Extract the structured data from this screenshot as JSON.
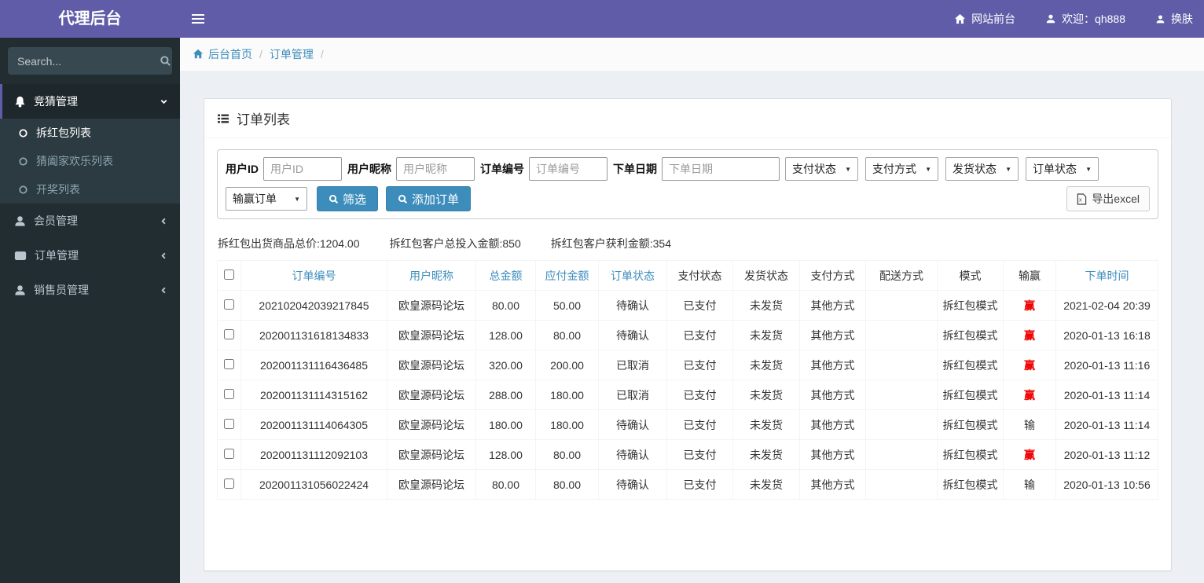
{
  "colors": {
    "accent": "#605ca8",
    "link": "#3c8dbc",
    "win_red": "#f00000",
    "sidebar_bg": "#222d32"
  },
  "app": {
    "title": "代理后台"
  },
  "navbar": {
    "links": [
      {
        "icon": "home-icon",
        "label": "网站前台"
      },
      {
        "icon": "user-icon",
        "label": "欢迎：qh888"
      },
      {
        "icon": "user-icon",
        "label": "换肤"
      }
    ]
  },
  "sidebar": {
    "search_placeholder": "Search...",
    "menu": [
      {
        "icon": "bell-icon",
        "label": "竞猜管理",
        "state": "open",
        "children": [
          {
            "label": "拆红包列表",
            "active": true
          },
          {
            "label": "猜阖家欢乐列表",
            "active": false
          },
          {
            "label": "开奖列表",
            "active": false
          }
        ]
      },
      {
        "icon": "user-icon",
        "label": "会员管理",
        "state": "collapsed"
      },
      {
        "icon": "card-icon",
        "label": "订单管理",
        "state": "collapsed"
      },
      {
        "icon": "user-icon",
        "label": "销售员管理",
        "state": "collapsed"
      }
    ]
  },
  "breadcrumb": {
    "items": [
      "后台首页",
      "订单管理"
    ],
    "separator": "/"
  },
  "panel": {
    "title": "订单列表"
  },
  "filters": {
    "fields": [
      {
        "label": "用户ID",
        "placeholder": "用户ID"
      },
      {
        "label": "用户昵称",
        "placeholder": "用户昵称"
      },
      {
        "label": "订单编号",
        "placeholder": "订单编号"
      },
      {
        "label": "下单日期",
        "placeholder": "下单日期"
      }
    ],
    "selects": [
      "支付状态",
      "支付方式",
      "发货状态",
      "订单状态"
    ],
    "win_select": "输赢订单",
    "buttons": {
      "filter": "筛选",
      "add": "添加订单",
      "export": "导出excel"
    }
  },
  "summary": [
    "拆红包出货商品总价:1204.00",
    "拆红包客户总投入金额:850",
    "拆红包客户获利金额:354"
  ],
  "table": {
    "win_value": "赢",
    "field_names": [
      "order-no",
      "nickname",
      "total-amount",
      "payable-amount",
      "order-status",
      "pay-status",
      "ship-status",
      "pay-method",
      "delivery-method",
      "mode",
      "win-lose",
      "order-time"
    ],
    "headers": [
      {
        "type": "checkbox",
        "label": ""
      },
      {
        "label": "订单编号",
        "link": true
      },
      {
        "label": "用户昵称",
        "link": true
      },
      {
        "label": "总金额",
        "link": true
      },
      {
        "label": "应付金额",
        "link": true
      },
      {
        "label": "订单状态",
        "link": true
      },
      {
        "label": "支付状态",
        "link": false
      },
      {
        "label": "发货状态",
        "link": false
      },
      {
        "label": "支付方式",
        "link": false
      },
      {
        "label": "配送方式",
        "link": false
      },
      {
        "label": "模式",
        "link": false
      },
      {
        "label": "输赢",
        "link": false
      },
      {
        "label": "下单时间",
        "link": true
      }
    ],
    "rows": [
      [
        "202102042039217845",
        "欧皇源码论坛",
        "80.00",
        "50.00",
        "待确认",
        "已支付",
        "未发货",
        "其他方式",
        "",
        "拆红包模式",
        "赢",
        "2021-02-04 20:39"
      ],
      [
        "202001131618134833",
        "欧皇源码论坛",
        "128.00",
        "80.00",
        "待确认",
        "已支付",
        "未发货",
        "其他方式",
        "",
        "拆红包模式",
        "赢",
        "2020-01-13 16:18"
      ],
      [
        "202001131116436485",
        "欧皇源码论坛",
        "320.00",
        "200.00",
        "已取消",
        "已支付",
        "未发货",
        "其他方式",
        "",
        "拆红包模式",
        "赢",
        "2020-01-13 11:16"
      ],
      [
        "202001131114315162",
        "欧皇源码论坛",
        "288.00",
        "180.00",
        "已取消",
        "已支付",
        "未发货",
        "其他方式",
        "",
        "拆红包模式",
        "赢",
        "2020-01-13 11:14"
      ],
      [
        "202001131114064305",
        "欧皇源码论坛",
        "180.00",
        "180.00",
        "待确认",
        "已支付",
        "未发货",
        "其他方式",
        "",
        "拆红包模式",
        "输",
        "2020-01-13 11:14"
      ],
      [
        "202001131112092103",
        "欧皇源码论坛",
        "128.00",
        "80.00",
        "待确认",
        "已支付",
        "未发货",
        "其他方式",
        "",
        "拆红包模式",
        "赢",
        "2020-01-13 11:12"
      ],
      [
        "202001131056022424",
        "欧皇源码论坛",
        "80.00",
        "80.00",
        "待确认",
        "已支付",
        "未发货",
        "其他方式",
        "",
        "拆红包模式",
        "输",
        "2020-01-13 10:56"
      ]
    ]
  }
}
